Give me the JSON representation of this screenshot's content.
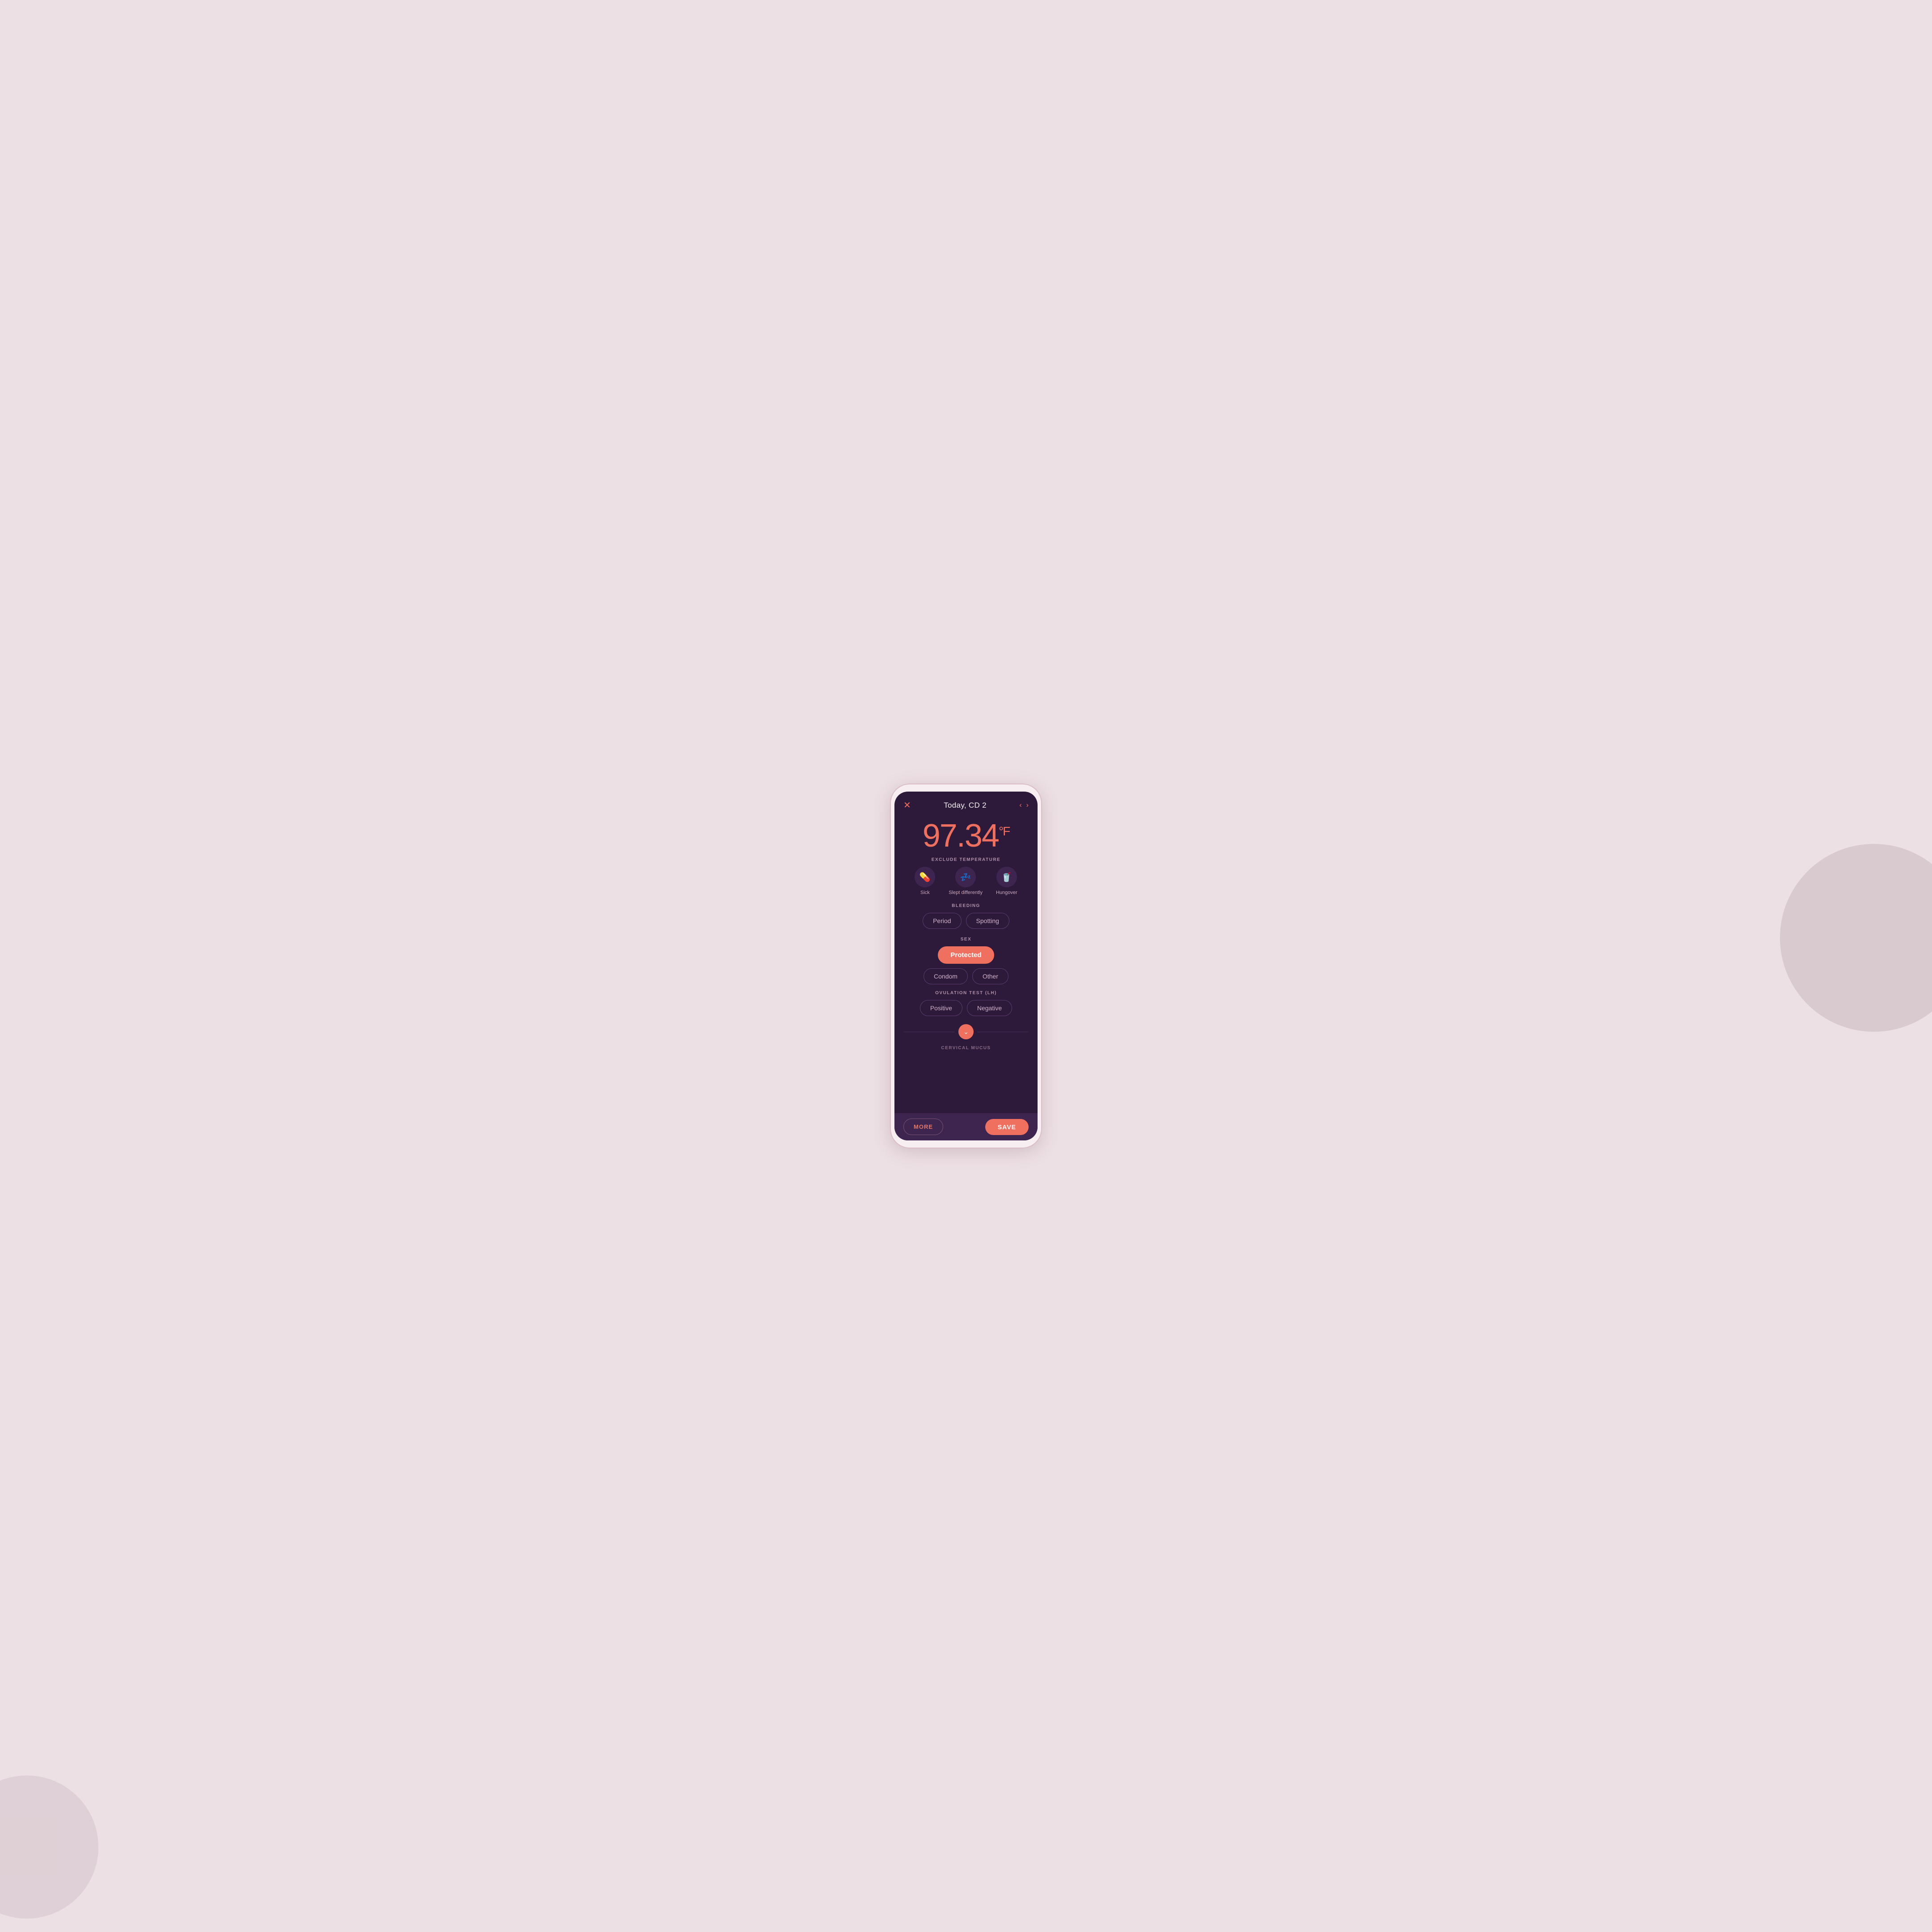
{
  "background": {
    "color": "#ede0e4"
  },
  "header": {
    "close_label": "✕",
    "title": "Today, CD 2",
    "nav_back": "‹",
    "nav_forward": "›"
  },
  "temperature": {
    "value": "97.34",
    "unit": "°F"
  },
  "exclude_temp": {
    "label": "EXCLUDE TEMPERATURE",
    "items": [
      {
        "icon": "💊",
        "label": "Sick"
      },
      {
        "icon": "💤",
        "label": "Slept differently"
      },
      {
        "icon": "🥤",
        "label": "Hungover"
      }
    ]
  },
  "bleeding": {
    "label": "BLEEDING",
    "buttons": [
      "Period",
      "Spotting"
    ]
  },
  "sex": {
    "label": "SEX",
    "selected": "Protected",
    "sub_buttons": [
      "Condom",
      "Other"
    ]
  },
  "ovulation": {
    "label": "OVULATION TEST (LH)",
    "buttons": [
      "Positive",
      "Negative"
    ]
  },
  "cervical": {
    "label": "CERVICAL MUCUS"
  },
  "bottom_bar": {
    "more_label": "MORE",
    "save_label": "SAVE"
  }
}
